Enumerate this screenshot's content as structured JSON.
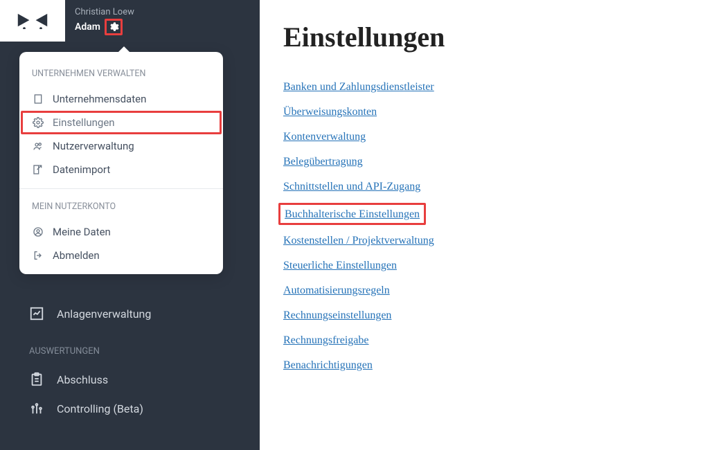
{
  "header": {
    "user_name": "Christian Loew",
    "company": "Adam"
  },
  "dropdown": {
    "section1_title": "UNTERNEHMEN VERWALTEN",
    "items1": [
      {
        "label": "Unternehmensdaten",
        "icon": "building-icon"
      },
      {
        "label": "Einstellungen",
        "icon": "gear-icon",
        "highlight": true
      },
      {
        "label": "Nutzerverwaltung",
        "icon": "users-icon"
      },
      {
        "label": "Datenimport",
        "icon": "import-icon"
      }
    ],
    "section2_title": "MEIN NUTZERKONTO",
    "items2": [
      {
        "label": "Meine Daten",
        "icon": "user-circle-icon"
      },
      {
        "label": "Abmelden",
        "icon": "logout-icon"
      }
    ]
  },
  "sidebar": {
    "item_assets": "Anlagenverwaltung",
    "section_reports": "AUSWERTUNGEN",
    "item_closing": "Abschluss",
    "item_controlling": "Controlling (Beta)"
  },
  "main": {
    "title": "Einstellungen",
    "links": [
      {
        "label": "Banken und Zahlungsdienstleister"
      },
      {
        "label": "Überweisungskonten"
      },
      {
        "label": "Kontenverwaltung"
      },
      {
        "label": "Belegübertragung"
      },
      {
        "label": "Schnittstellen und API-Zugang"
      },
      {
        "label": "Buchhalterische Einstellungen",
        "highlight": true
      },
      {
        "label": "Kostenstellen / Projektverwaltung"
      },
      {
        "label": "Steuerliche Einstellungen"
      },
      {
        "label": "Automatisierungsregeln"
      },
      {
        "label": "Rechnungseinstellungen"
      },
      {
        "label": "Rechnungsfreigabe"
      },
      {
        "label": "Benachrichtigungen"
      }
    ]
  }
}
